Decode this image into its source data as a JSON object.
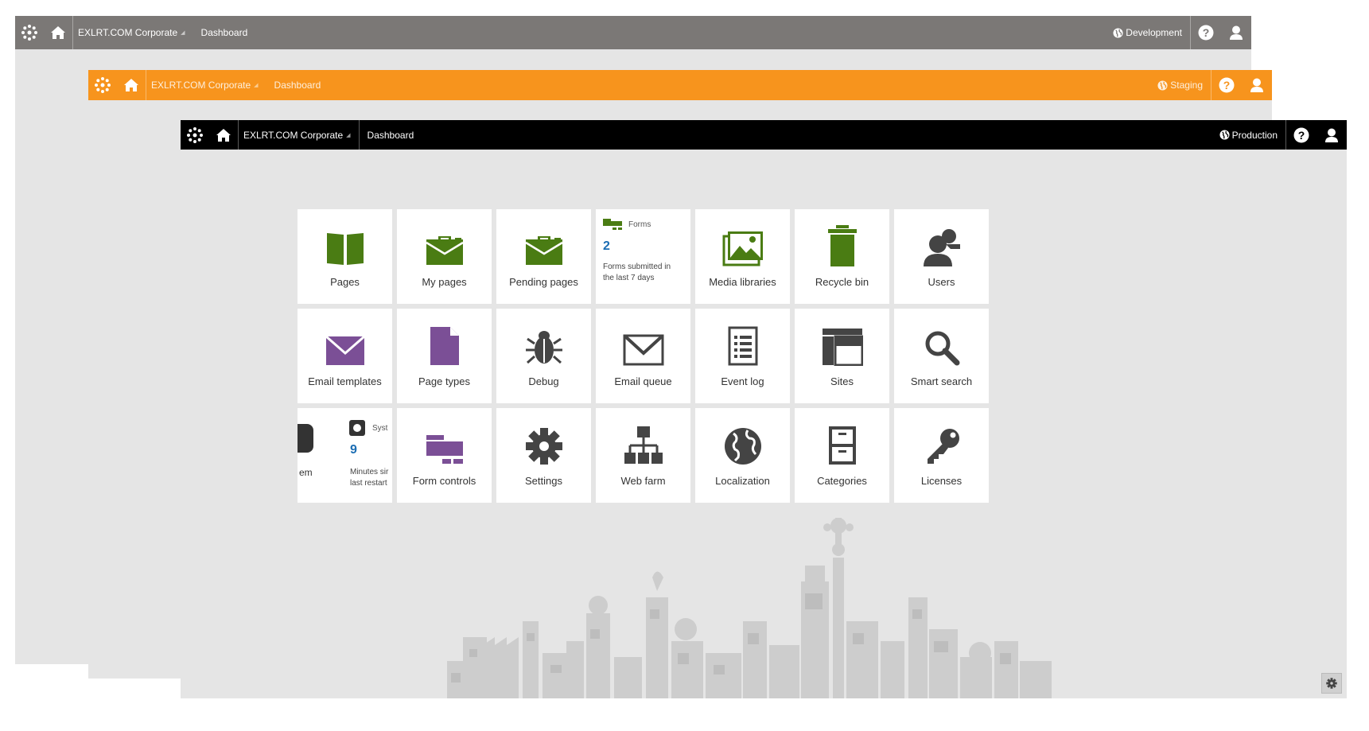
{
  "windows": {
    "development": {
      "site": "EXLRT.COM Corporate",
      "crumb": "Dashboard",
      "environment": "Development",
      "color": "#7b7876"
    },
    "staging": {
      "site": "EXLRT.COM Corporate",
      "crumb": "Dashboard",
      "environment": "Staging",
      "color": "#f7941d"
    },
    "production": {
      "site": "EXLRT.COM Corporate",
      "crumb": "Dashboard",
      "environment": "Production",
      "color": "#000000"
    }
  },
  "icons": {
    "logo": "kentico-logo-icon",
    "home": "home-icon",
    "help": "help-icon",
    "user": "user-icon",
    "environment": "globe-icon",
    "settings": "gear-icon"
  },
  "colors": {
    "green": "#4a7c13",
    "purple": "#7b4f96",
    "gray": "#444444",
    "accent_blue": "#1b6db3",
    "background": "#e5e5e5"
  },
  "tiles": {
    "pages": "Pages",
    "my_pages": "My pages",
    "pending_pages": "Pending pages",
    "forms": {
      "title": "Forms",
      "value": "2",
      "desc_line1": "Forms submitted in",
      "desc_line2": "the last 7 days"
    },
    "media_libraries": "Media libraries",
    "recycle_bin": "Recycle bin",
    "users": "Users",
    "email_templates": "Email templates",
    "page_types": "Page types",
    "debug": "Debug",
    "email_queue": "Email queue",
    "event_log": "Event log",
    "sites": "Sites",
    "smart_search": "Smart search",
    "system": {
      "left_label": "em",
      "title": "Syst",
      "value": "9",
      "desc_line1": "Minutes sir",
      "desc_line2": "last restart"
    },
    "form_controls": "Form controls",
    "settings": "Settings",
    "web_farm": "Web farm",
    "localization": "Localization",
    "categories": "Categories",
    "licenses": "Licenses"
  }
}
